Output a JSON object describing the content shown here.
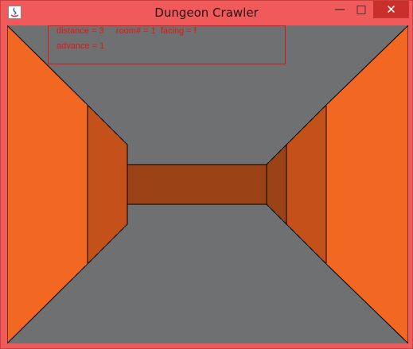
{
  "window": {
    "title": "Dungeon Crawler",
    "controls": {
      "minimize_icon": "minimize-icon",
      "maximize_icon": "maximize-icon",
      "close_icon": "close-icon"
    },
    "app_icon": "java-icon"
  },
  "hud": {
    "line1": "distance = 3     room# = 1  facing = f",
    "line2": "advance = 1"
  },
  "colors": {
    "frame": "#f15a5a",
    "floor_ceiling": "#6e7071",
    "wall_near": "#f26822",
    "wall_mid": "#c4501a",
    "wall_far": "#9a4215",
    "hud_text": "#e01818"
  }
}
